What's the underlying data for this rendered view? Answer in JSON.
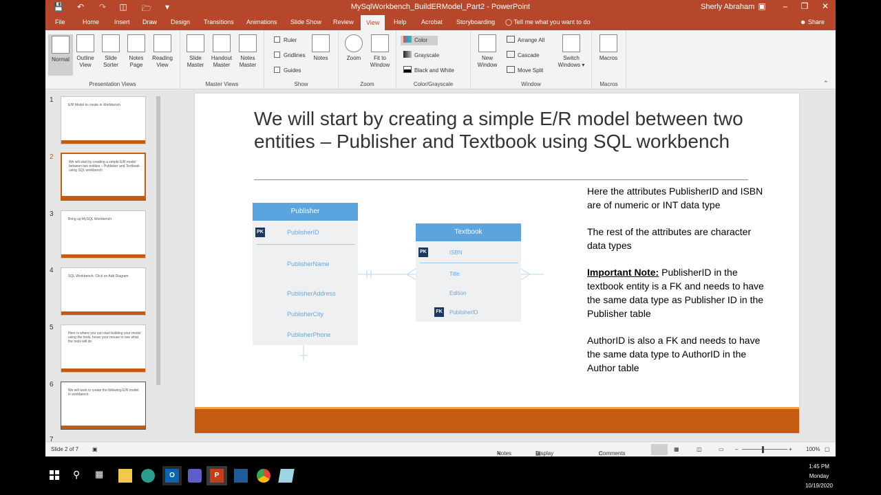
{
  "window": {
    "title": "MySqlWorkbench_BuildERModel_Part2 - PowerPoint",
    "user": "Sherly Abraham"
  },
  "tabs": [
    "File",
    "Home",
    "Insert",
    "Draw",
    "Design",
    "Transitions",
    "Animations",
    "Slide Show",
    "Review",
    "View",
    "Help",
    "Acrobat",
    "Storyboarding"
  ],
  "active_tab": "View",
  "tell_me": "Tell me what you want to do",
  "share": "Share",
  "ribbon": {
    "presentation_views": {
      "label": "Presentation Views",
      "normal": "Normal",
      "outline_view": "Outline View",
      "slide_sorter": "Slide Sorter",
      "notes_page": "Notes Page",
      "reading_view": "Reading View"
    },
    "master_views": {
      "label": "Master Views",
      "slide_master": "Slide Master",
      "handout_master": "Handout Master",
      "notes_master": "Notes Master"
    },
    "show": {
      "label": "Show",
      "ruler": "Ruler",
      "gridlines": "Gridlines",
      "guides": "Guides",
      "notes": "Notes"
    },
    "zoom": {
      "label": "Zoom",
      "zoom": "Zoom",
      "fit_to_window": "Fit to Window"
    },
    "color_grayscale": {
      "label": "Color/Grayscale",
      "color": "Color",
      "grayscale": "Grayscale",
      "black_and_white": "Black and White"
    },
    "window_group": {
      "label": "Window",
      "new_window": "New Window",
      "arrange_all": "Arrange All",
      "cascade": "Cascade",
      "move_split": "Move Split",
      "switch_windows": "Switch Windows"
    },
    "macros": {
      "label": "Macros",
      "macros": "Macros"
    }
  },
  "thumbnails": [
    {
      "num": "1",
      "title": "E/R Model to create in Workbench"
    },
    {
      "num": "2",
      "title": "We will start by creating a simple E/R model between two entities – Publisher and Textbook using SQL workbench"
    },
    {
      "num": "3",
      "title": "Bring up MySQL Workbench"
    },
    {
      "num": "4",
      "title": "SQL Workbench- Click on Add Diagram"
    },
    {
      "num": "5",
      "title": "Here is where you can start building your model using the tools, hover your mouse to see what the tools will do"
    },
    {
      "num": "6",
      "title": "We will work to create the following E/R model in workbench:"
    },
    {
      "num": "7",
      "title": ""
    }
  ],
  "slide": {
    "title": "We will start by creating a simple E/R model between two entities – Publisher and Textbook using SQL workbench",
    "body": {
      "p1": "Here the attributes PublisherID and ISBN are of numeric or INT data type",
      "p2": "The rest of the attributes are character data types",
      "p3_label": "Important Note:",
      "p3_text": " PublisherID in the textbook entity is a FK and needs to have the same data type as Publisher ID in the Publisher table",
      "p4": "AuthorID is also a FK and needs to have the same data type to AuthorID in the Author table"
    },
    "publisher": {
      "name": "Publisher",
      "pk": "PK",
      "pk_attr": "PublisherID",
      "attrs": [
        "PublisherName",
        "PublisherAddress",
        "PublisherCity",
        "PublisherPhone"
      ]
    },
    "textbook": {
      "name": "Textbook",
      "pk": "PK",
      "pk_attr": "ISBN",
      "attrs": [
        "Title",
        "Edition"
      ],
      "fk": "FK",
      "fk_attr": "PublisherID"
    }
  },
  "status": {
    "slide_of": "Slide 2 of 7",
    "notes": "Notes",
    "display_settings": "Display Settings",
    "comments": "Comments",
    "zoom": "100%"
  },
  "clock": {
    "time": "1:45 PM",
    "day": "Monday",
    "date": "10/19/2020"
  },
  "colors": {
    "accent": "#b7472a",
    "slide_bar": "#c55a11",
    "entity_header": "#5aa4e0",
    "key_badge": "#173a5e"
  }
}
